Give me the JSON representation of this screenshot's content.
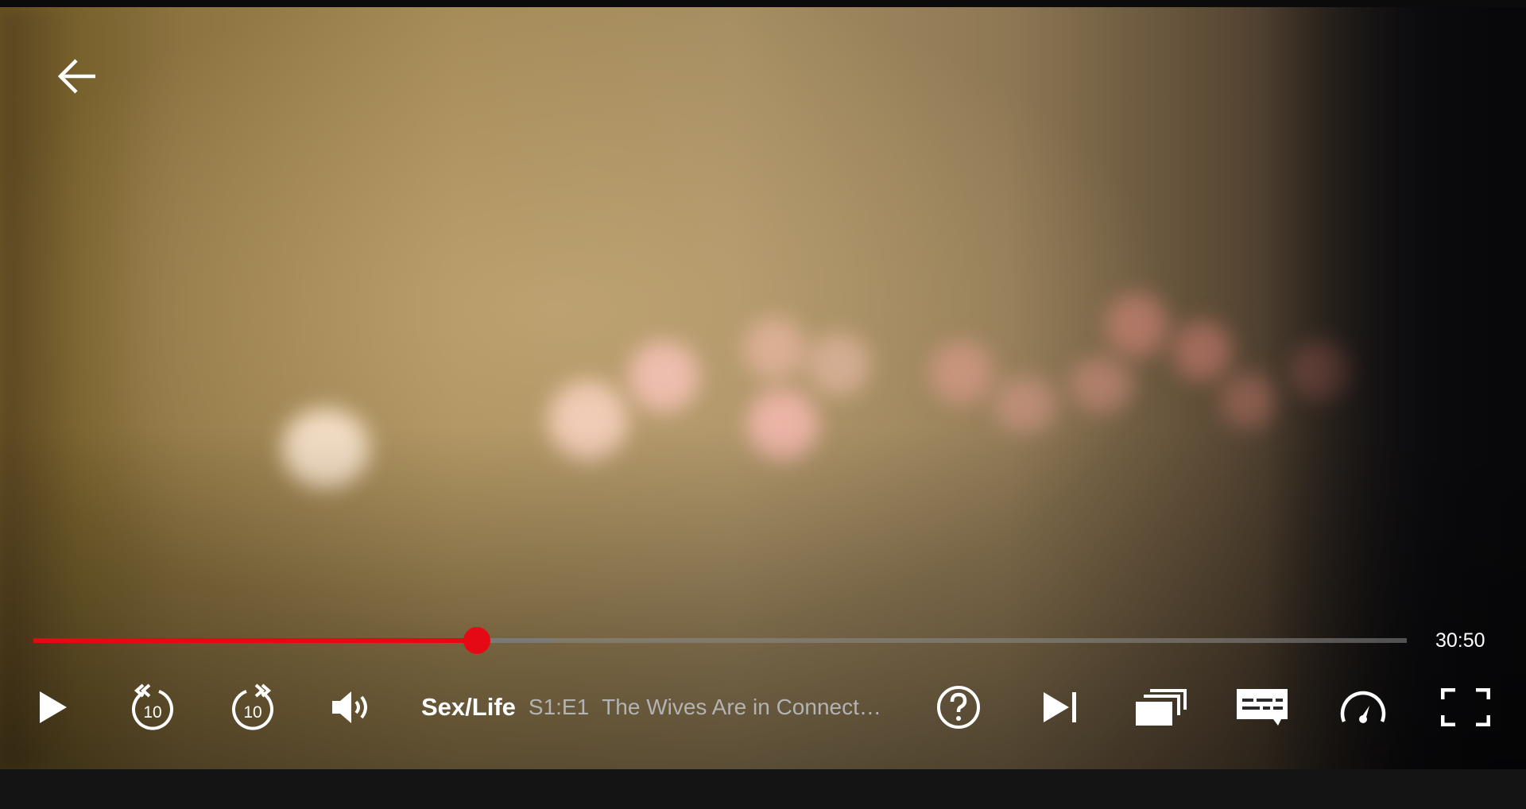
{
  "player": {
    "show_title": "Sex/Life",
    "episode_number": "S1:E1",
    "episode_title": "The Wives Are in Connect…",
    "time_remaining": "30:50",
    "progress_played_fraction": 0.323,
    "progress_buffered_fraction": 0.378,
    "accent_color": "#e50914",
    "skip_back_seconds": "10",
    "skip_forward_seconds": "10"
  },
  "icons": {
    "back": "back-arrow-icon",
    "play": "play-icon",
    "rewind": "rewind-10-icon",
    "forward": "forward-10-icon",
    "volume": "volume-icon",
    "help": "help-icon",
    "next_episode": "next-episode-icon",
    "episodes": "episodes-icon",
    "subtitles": "subtitles-icon",
    "speed": "playback-speed-icon",
    "fullscreen": "fullscreen-icon"
  }
}
